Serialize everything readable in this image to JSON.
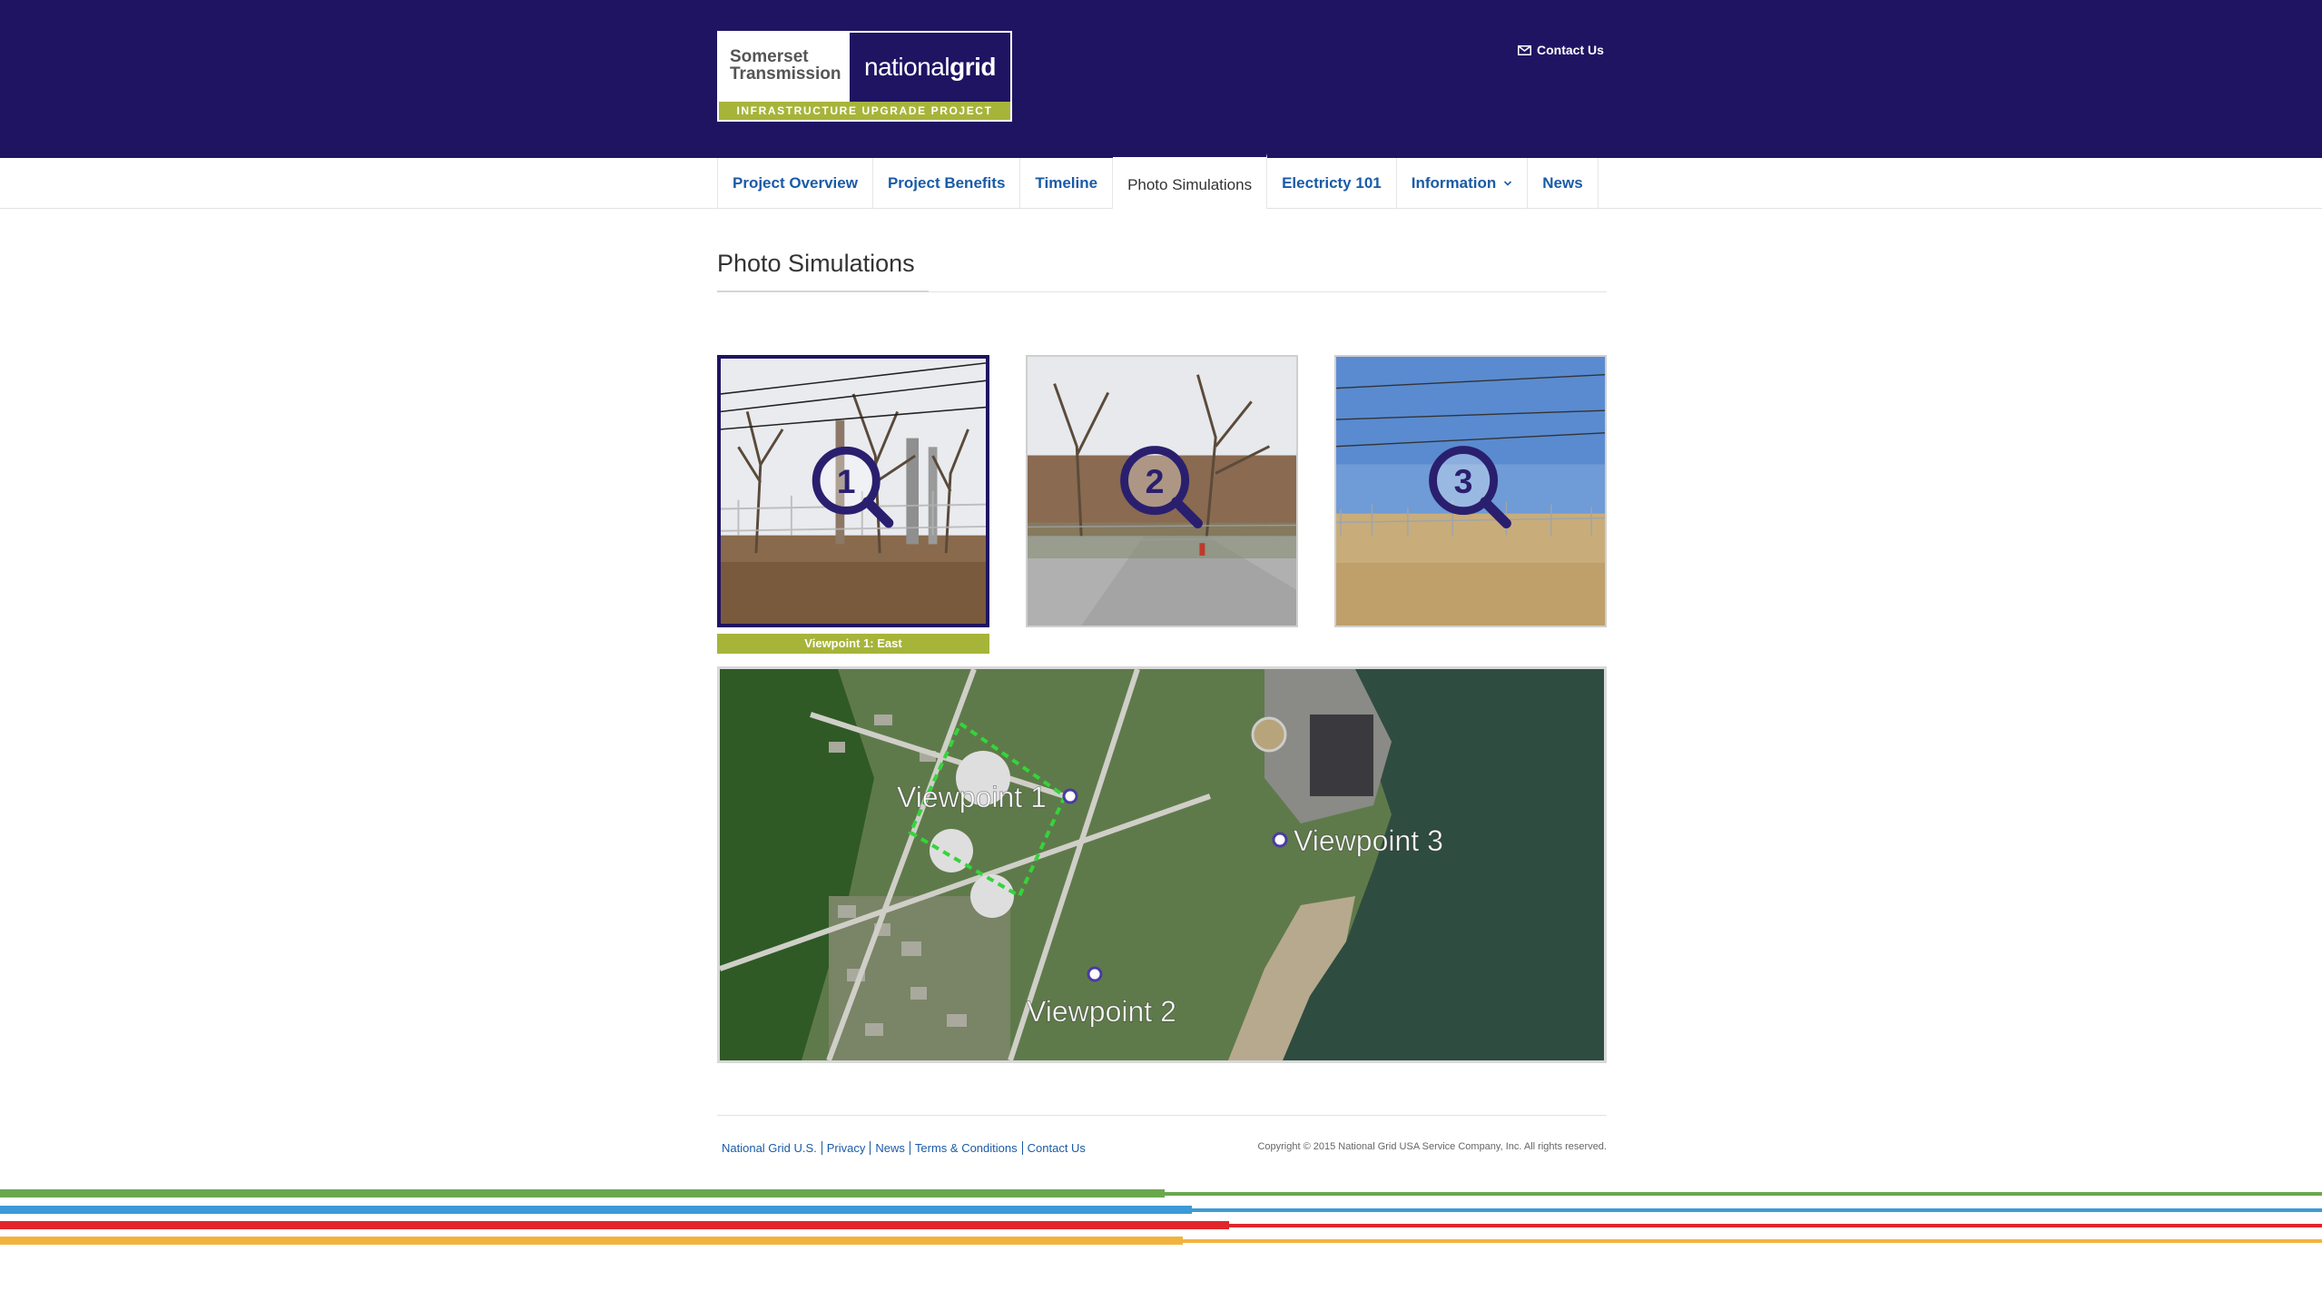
{
  "header": {
    "logo": {
      "left_line1": "Somerset",
      "left_line2": "Transmission",
      "brand_part1": "national",
      "brand_part2": "grid",
      "tagline": "INFRASTRUCTURE UPGRADE PROJECT"
    },
    "contact_label": "Contact Us",
    "contact_icon": "envelope-icon",
    "background_color": "#1f1462"
  },
  "nav": {
    "items": [
      {
        "label": "Project Overview",
        "active": false
      },
      {
        "label": "Project Benefits",
        "active": false
      },
      {
        "label": "Timeline",
        "active": false
      },
      {
        "label": "Photo Simulations",
        "active": true
      },
      {
        "label": "Electricty 101",
        "active": false
      },
      {
        "label": "Information",
        "active": false,
        "dropdown": true
      },
      {
        "label": "News",
        "active": false
      }
    ]
  },
  "main": {
    "page_title": "Photo Simulations",
    "thumbnails": [
      {
        "number": "1",
        "selected": true,
        "icon": "magnifier-icon"
      },
      {
        "number": "2",
        "selected": false,
        "icon": "magnifier-icon"
      },
      {
        "number": "3",
        "selected": false,
        "icon": "magnifier-icon"
      }
    ],
    "selected_caption": "Viewpoint 1: East",
    "map": {
      "labels": [
        "Viewpoint 1",
        "Viewpoint 2",
        "Viewpoint 3"
      ]
    }
  },
  "footer": {
    "links": [
      "National Grid U.S.",
      "Privacy",
      "News",
      "Terms & Conditions",
      "Contact Us"
    ],
    "copyright": "Copyright © 2015 National Grid USA Service Company, Inc. All rights reserved."
  },
  "colors": {
    "brand_navy": "#1f1462",
    "accent_green": "#a7b43a",
    "link_blue": "#1a5ba6",
    "stripe_green": "#6aa84f",
    "stripe_blue": "#3d9ad6",
    "stripe_red": "#e0262a",
    "stripe_yellow": "#f2b33d"
  }
}
